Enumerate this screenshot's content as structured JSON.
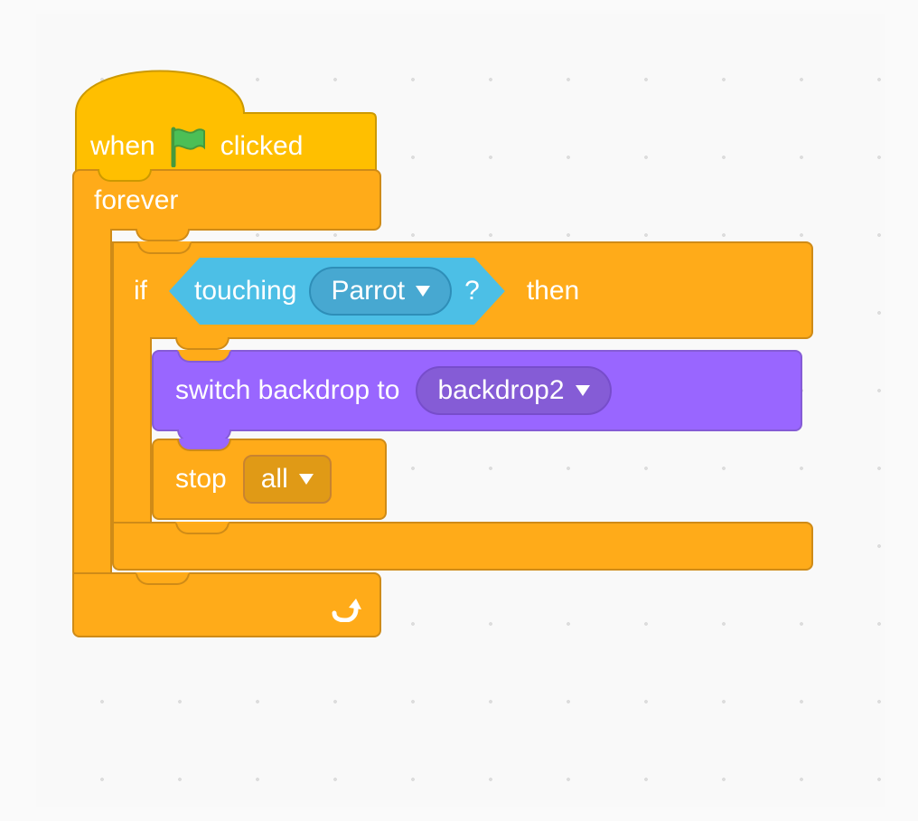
{
  "colors": {
    "events": "#ffbf00",
    "events_border": "#cc9900",
    "control": "#ffab19",
    "control_border": "#cf8b17",
    "sensing": "#4cbfe6",
    "looks": "#9966ff",
    "flag": "#4cbf56"
  },
  "hat": {
    "when": "when",
    "clicked": "clicked",
    "icon": "green-flag-icon"
  },
  "forever": {
    "label": "forever"
  },
  "if_block": {
    "if": "if",
    "then": "then"
  },
  "touching": {
    "label": "touching",
    "option": "Parrot",
    "suffix": "?"
  },
  "switch_backdrop": {
    "label": "switch backdrop to",
    "option": "backdrop2"
  },
  "stop": {
    "label": "stop",
    "option": "all"
  }
}
